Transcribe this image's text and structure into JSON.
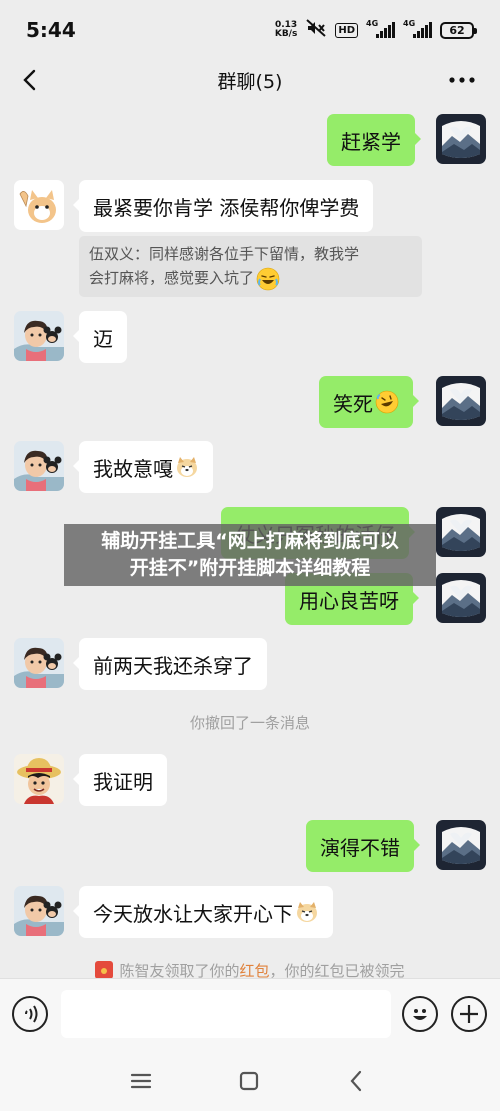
{
  "status_bar": {
    "time": "5:44",
    "net_speed_value": "0.13",
    "net_speed_unit": "KB/s",
    "hd_label": "HD",
    "signal1_label": "4G",
    "signal2_label": "4G",
    "battery": "62"
  },
  "nav": {
    "title": "群聊(5)",
    "back_icon": "chevron-left-icon",
    "more_icon": "more-dots-icon"
  },
  "messages": [
    {
      "side": "out",
      "text": "赶紧学",
      "avatar": "mountain-landscape"
    },
    {
      "side": "in",
      "text": "最紧要你肯学 添侯帮你俾学费",
      "avatar": "cat-thumbs-up"
    },
    {
      "side": "quote",
      "text_line1": "伍双义：同样感谢各位手下留情，教我学",
      "text_line2": "会打麻将，感觉要入坑了"
    },
    {
      "side": "in",
      "text": "迈",
      "avatar": "boy-with-mickey"
    },
    {
      "side": "out",
      "text": "笑死",
      "avatar": "mountain-landscape"
    },
    {
      "side": "in",
      "text": "我故意嘎",
      "avatar": "boy-with-mickey"
    },
    {
      "side": "out",
      "text": "仗义只冤秒的活仔",
      "avatar": "mountain-landscape"
    },
    {
      "side": "out",
      "text": "用心良苦呀",
      "avatar": "mountain-landscape"
    },
    {
      "side": "in",
      "text": "前两天我还杀穿了",
      "avatar": "boy-with-mickey"
    },
    {
      "side": "system",
      "text": "你撤回了一条消息"
    },
    {
      "side": "in",
      "text": "我证明",
      "avatar": "luffy-straw-hat"
    },
    {
      "side": "out",
      "text": "演得不错",
      "avatar": "mountain-landscape"
    },
    {
      "side": "in",
      "text": "今天放水让大家开心下",
      "avatar": "boy-with-mickey"
    },
    {
      "side": "redpacket",
      "prefix": "陈智友领取了你的",
      "highlight": "红包",
      "suffix": "，你的红包已被领完"
    }
  ],
  "overlay": {
    "line1": "辅助开挂工具“网上打麻将到底可以",
    "line2": "开挂不”附开挂脚本详细教程"
  },
  "input_bar": {
    "voice_icon": "voice-icon",
    "emoji_icon": "smile-icon",
    "plus_icon": "plus-icon"
  },
  "system_nav": {
    "menu_icon": "menu-icon",
    "home_icon": "home-icon",
    "back_icon": "back-icon"
  },
  "colors": {
    "background": "#ededed",
    "bubble_out": "#95ec69",
    "bubble_in": "#ffffff",
    "red_packet_highlight": "#e0823c"
  }
}
